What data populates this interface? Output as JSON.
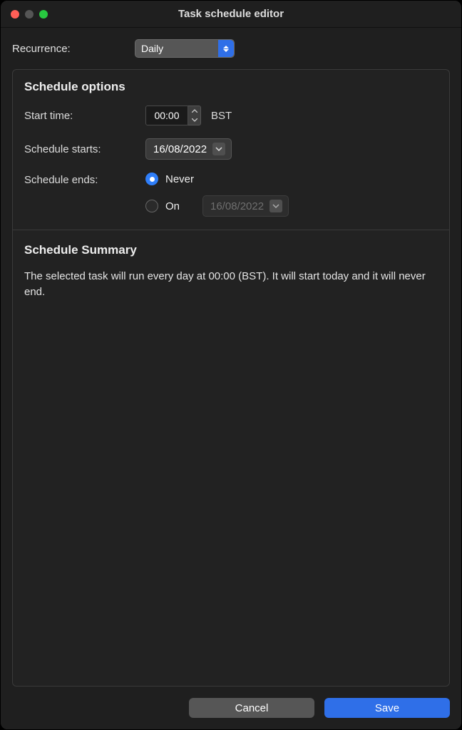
{
  "window": {
    "title": "Task schedule editor"
  },
  "recurrence": {
    "label": "Recurrence:",
    "value": "Daily"
  },
  "schedule_options": {
    "heading": "Schedule options",
    "start_time": {
      "label": "Start time:",
      "value": "00:00",
      "tz": "BST"
    },
    "schedule_starts": {
      "label": "Schedule starts:",
      "date": "16/08/2022"
    },
    "schedule_ends": {
      "label": "Schedule ends:",
      "selected": "never",
      "never_label": "Never",
      "on_label": "On",
      "on_date": "16/08/2022"
    }
  },
  "summary": {
    "heading": "Schedule Summary",
    "text": "The selected task will run every day at 00:00 (BST). It will start today and it will never end."
  },
  "footer": {
    "cancel": "Cancel",
    "save": "Save"
  }
}
